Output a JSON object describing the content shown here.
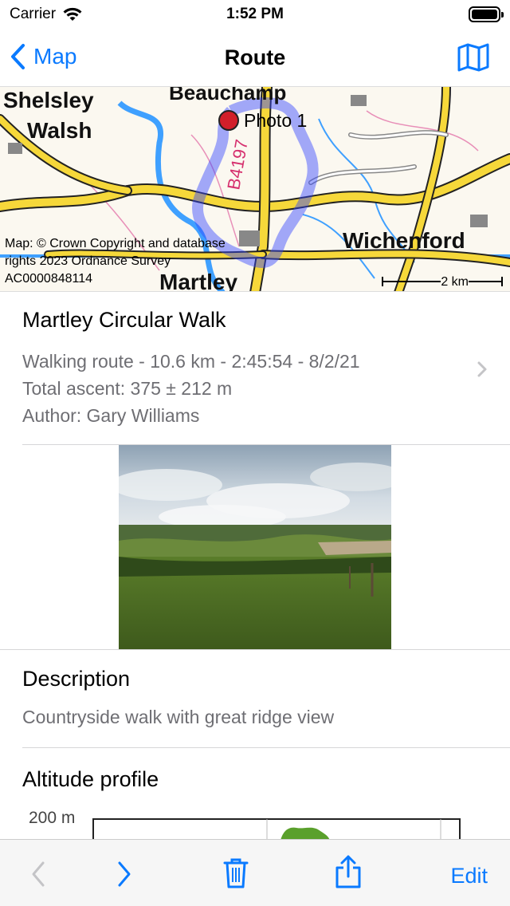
{
  "status": {
    "carrier": "Carrier",
    "time": "1:52 PM",
    "wifi_icon": "wifi-icon",
    "battery_icon": "battery-icon"
  },
  "nav": {
    "back_label": "Map",
    "title": "Route",
    "map_icon": "map-icon"
  },
  "map": {
    "place_labels": [
      "Shelsley",
      "Walsh",
      "Beauchamp",
      "Wichenford",
      "Martley",
      "B4197"
    ],
    "marker_label": "Photo 1",
    "credit": "Map: © Crown Copyright and database rights 2023 Ordnance Survey AC0000848114",
    "scale": "2 km"
  },
  "route": {
    "title": "Martley Circular Walk",
    "line1": "Walking route - 10.6 km - 2:45:54 - 8/2/21",
    "line2": "Total ascent: 375 ± 212 m",
    "line3": "Author: Gary Williams"
  },
  "description": {
    "title": "Description",
    "text": "Countryside walk with great ridge view"
  },
  "altitude": {
    "title": "Altitude profile",
    "axis_label": "200 m"
  },
  "toolbar": {
    "edit_label": "Edit",
    "accent": "#0a7aff"
  }
}
